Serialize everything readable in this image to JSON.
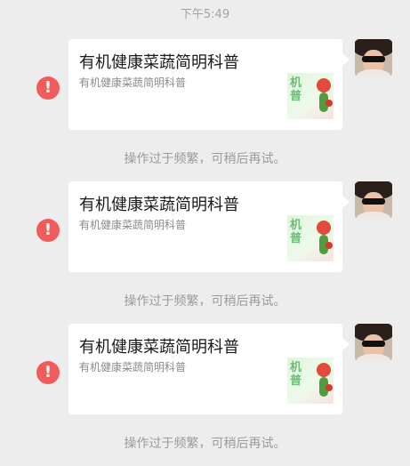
{
  "timestamp": "下午5:49",
  "messages": [
    {
      "title": "有机健康菜蔬简明科普",
      "description": "有机健康菜蔬简明科普",
      "thumb_text": "机普",
      "notice": "操作过于频繁，可稍后再试。"
    },
    {
      "title": "有机健康菜蔬简明科普",
      "description": "有机健康菜蔬简明科普",
      "thumb_text": "机普",
      "notice": "操作过于频繁，可稍后再试。"
    },
    {
      "title": "有机健康菜蔬简明科普",
      "description": "有机健康菜蔬简明科普",
      "thumb_text": "机普",
      "notice": "操作过于频繁，可稍后再试。"
    }
  ],
  "error_icon_glyph": "!",
  "colors": {
    "background": "#ededed",
    "error": "#f05b5b",
    "card": "#ffffff"
  }
}
